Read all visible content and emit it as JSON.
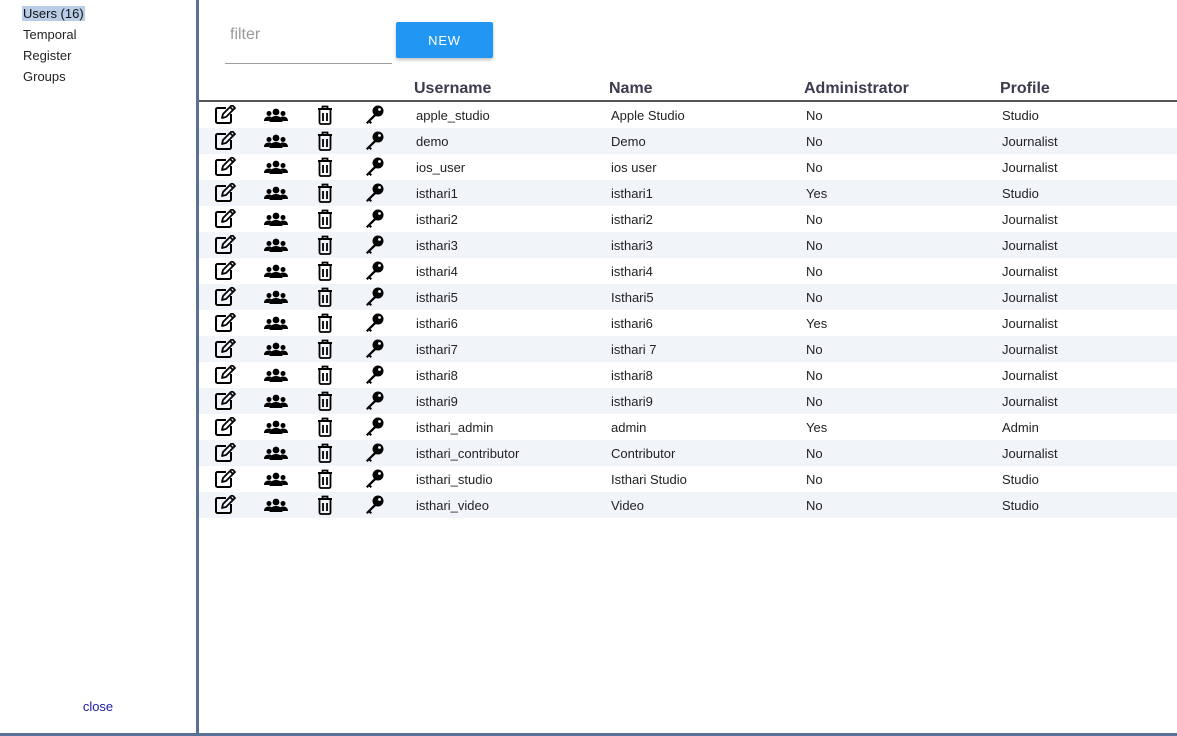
{
  "sidebar": {
    "items": [
      {
        "label": "Users (16)",
        "active": true
      },
      {
        "label": "Temporal",
        "active": false
      },
      {
        "label": "Register",
        "active": false
      },
      {
        "label": "Groups",
        "active": false
      }
    ],
    "close_label": "close"
  },
  "toolbar": {
    "filter_placeholder": "filter",
    "filter_value": "",
    "new_label": "NEW"
  },
  "table": {
    "columns": [
      "Username",
      "Name",
      "Administrator",
      "Profile"
    ],
    "row_action_icons": [
      "edit-icon",
      "groups-icon",
      "trash-icon",
      "key-icon"
    ],
    "rows": [
      {
        "username": "apple_studio",
        "name": "Apple Studio",
        "admin": "No",
        "profile": "Studio"
      },
      {
        "username": "demo",
        "name": "Demo",
        "admin": "No",
        "profile": "Journalist"
      },
      {
        "username": "ios_user",
        "name": "ios user",
        "admin": "No",
        "profile": "Journalist"
      },
      {
        "username": "isthari1",
        "name": "isthari1",
        "admin": "Yes",
        "profile": "Studio"
      },
      {
        "username": "isthari2",
        "name": "isthari2",
        "admin": "No",
        "profile": "Journalist"
      },
      {
        "username": "isthari3",
        "name": "isthari3",
        "admin": "No",
        "profile": "Journalist"
      },
      {
        "username": "isthari4",
        "name": "isthari4",
        "admin": "No",
        "profile": "Journalist"
      },
      {
        "username": "isthari5",
        "name": "Isthari5",
        "admin": "No",
        "profile": "Journalist"
      },
      {
        "username": "isthari6",
        "name": "isthari6",
        "admin": "Yes",
        "profile": "Journalist"
      },
      {
        "username": "isthari7",
        "name": "isthari 7",
        "admin": "No",
        "profile": "Journalist"
      },
      {
        "username": "isthari8",
        "name": "isthari8",
        "admin": "No",
        "profile": "Journalist"
      },
      {
        "username": "isthari9",
        "name": "isthari9",
        "admin": "No",
        "profile": "Journalist"
      },
      {
        "username": "isthari_admin",
        "name": "admin",
        "admin": "Yes",
        "profile": "Admin"
      },
      {
        "username": "isthari_contributor",
        "name": "Contributor",
        "admin": "No",
        "profile": "Journalist"
      },
      {
        "username": "isthari_studio",
        "name": "Isthari Studio",
        "admin": "No",
        "profile": "Studio"
      },
      {
        "username": "isthari_video",
        "name": "Video",
        "admin": "No",
        "profile": "Studio"
      }
    ]
  },
  "colors": {
    "accent": "#2196f3",
    "divider": "#5a7197",
    "row_alt": "#f1f5fa",
    "selected_bg": "#b9cde8",
    "link": "#1a1aa6"
  }
}
